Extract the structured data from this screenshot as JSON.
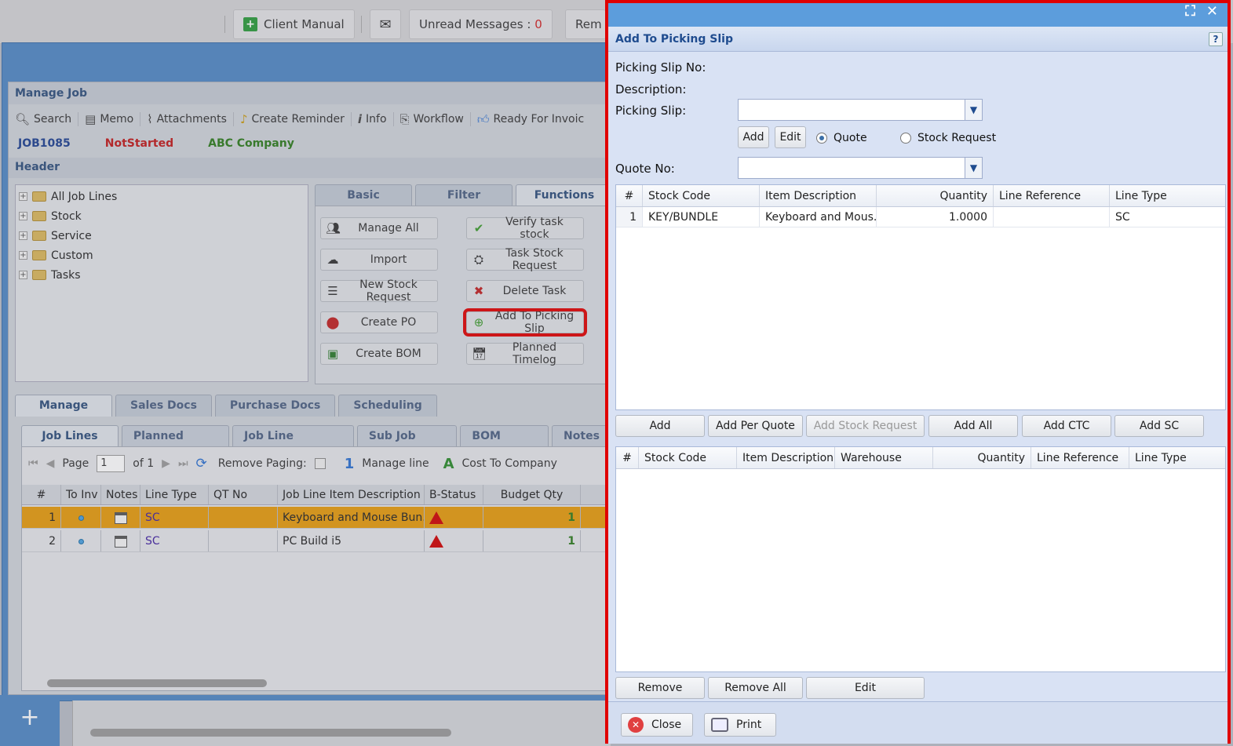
{
  "topbar": {
    "client_manual": "Client Manual",
    "unread_label": "Unread Messages : ",
    "unread_count": "0",
    "reminders_partial": "Rem"
  },
  "manage_job": {
    "title": "Manage Job",
    "toolbar": [
      "Search",
      "Memo",
      "Attachments",
      "Create Reminder",
      "Info",
      "Workflow",
      "Ready For Invoic"
    ],
    "job_no": "JOB1085",
    "status": "NotStarted",
    "company": "ABC Company",
    "header_label": "Header",
    "tree": [
      "All Job Lines",
      "Stock",
      "Service",
      "Custom",
      "Tasks"
    ],
    "function_tabs": [
      "Basic",
      "Filter",
      "Functions"
    ],
    "functions": {
      "manage_all": "Manage All",
      "verify_task_stock": "Verify task stock",
      "import": "Import",
      "task_stock_request": "Task Stock Request",
      "new_stock_request": "New Stock Request",
      "delete_task": "Delete Task",
      "create_po": "Create PO",
      "add_to_picking_slip": "Add To Picking Slip",
      "create_bom": "Create BOM",
      "planned_timelog": "Planned Timelog"
    },
    "main_tabs": [
      "Manage",
      "Sales Docs",
      "Purchase Docs",
      "Scheduling"
    ],
    "sub_tabs": [
      "Job Lines",
      "Planned Time",
      "Job Line History",
      "Sub Job Link",
      "BOM Links",
      "Notes"
    ],
    "pager": {
      "page_label": "Page",
      "page_value": "1",
      "of_label": "of 1",
      "remove_paging": "Remove Paging:",
      "manage_line_num": "1",
      "manage_line": "Manage line",
      "ctc_letter": "A",
      "cost_to_company": "Cost To Company"
    },
    "grid_headers": [
      "#",
      "To Inv",
      "Notes",
      "Line Type",
      "QT No",
      "Job Line Item Description",
      "B-Status",
      "Budget Qty"
    ],
    "grid_rows": [
      {
        "num": "1",
        "line_type": "SC",
        "qt_no": "",
        "desc": "Keyboard and Mouse Bun...",
        "budget_qty": "1"
      },
      {
        "num": "2",
        "line_type": "SC",
        "qt_no": "",
        "desc": "PC Build i5",
        "budget_qty": "1"
      }
    ]
  },
  "dialog": {
    "title": "Add To Picking Slip",
    "help": "?",
    "picking_slip_no_label": "Picking Slip No:",
    "description_label": "Description:",
    "picking_slip_label": "Picking Slip:",
    "picking_slip_value": "",
    "add_btn": "Add",
    "edit_btn": "Edit",
    "radio_quote": "Quote",
    "radio_stock_request": "Stock Request",
    "quote_no_label": "Quote No:",
    "quote_no_value": "",
    "upper_headers": [
      "#",
      "Stock Code",
      "Item Description",
      "Quantity",
      "Line Reference",
      "Line Type"
    ],
    "upper_rows": [
      {
        "num": "1",
        "stock_code": "KEY/BUNDLE",
        "desc": "Keyboard and Mous...",
        "qty": "1.0000",
        "ref": "",
        "type": "SC"
      }
    ],
    "mid_buttons": [
      "Add",
      "Add Per Quote",
      "Add Stock Request",
      "Add All",
      "Add CTC",
      "Add SC"
    ],
    "lower_headers": [
      "#",
      "Stock Code",
      "Item Description",
      "Warehouse",
      "Quantity",
      "Line Reference",
      "Line Type"
    ],
    "lower_buttons": [
      "Remove",
      "Remove All",
      "Edit"
    ],
    "close_btn": "Close",
    "print_btn": "Print"
  },
  "colors": {
    "highlight": "#e00000",
    "accent": "#5c9ddc",
    "selected_row": "#e69a0a"
  }
}
